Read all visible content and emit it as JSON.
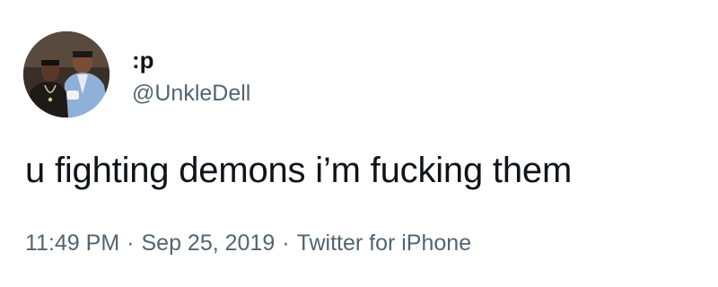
{
  "tweet": {
    "display_name": ":p",
    "handle": "@UnkleDell",
    "text": "u fighting demons i’m fucking them",
    "time": "11:49 PM",
    "date": "Sep 25, 2019",
    "source": "Twitter for iPhone",
    "separator": "·"
  },
  "colors": {
    "primary_text": "#0f1419",
    "secondary_text": "#536471",
    "background": "#ffffff"
  },
  "icons": {
    "avatar": "profile-photo"
  }
}
